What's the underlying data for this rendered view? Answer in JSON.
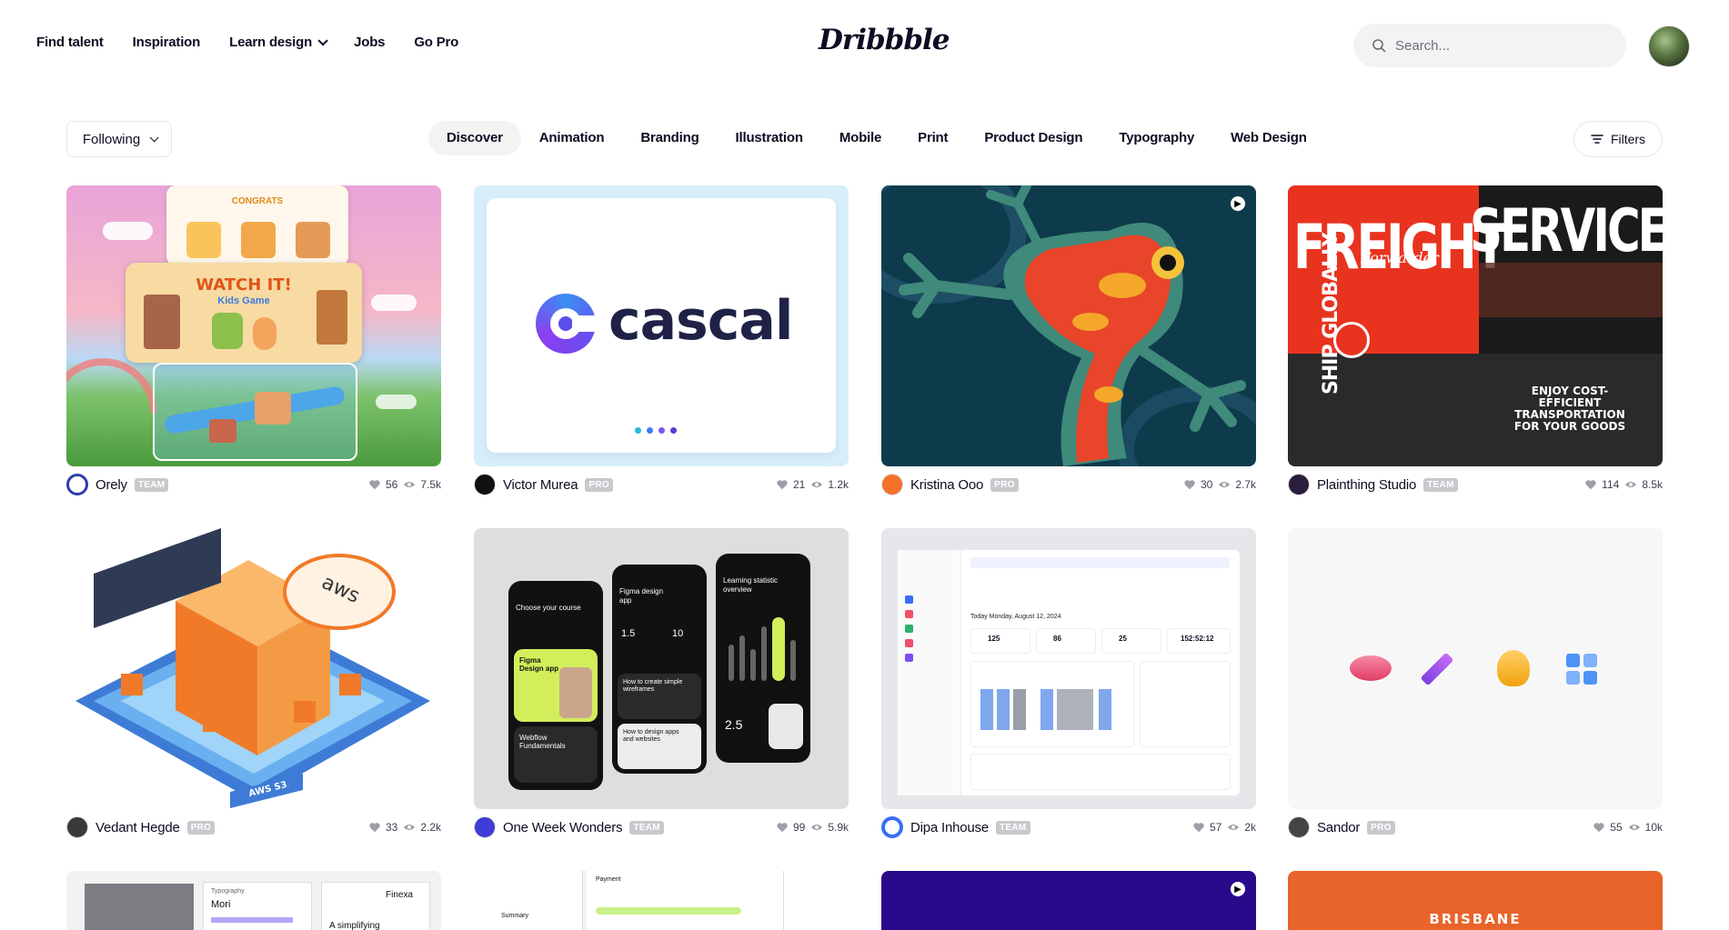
{
  "header": {
    "nav": [
      {
        "label": "Find talent"
      },
      {
        "label": "Inspiration"
      },
      {
        "label": "Learn design"
      },
      {
        "label": "Jobs"
      },
      {
        "label": "Go Pro"
      }
    ],
    "logo": "Dribbble",
    "search_placeholder": "Search..."
  },
  "filters_row": {
    "following": "Following",
    "categories": [
      "Discover",
      "Animation",
      "Branding",
      "Illustration",
      "Mobile",
      "Print",
      "Product Design",
      "Typography",
      "Web Design"
    ],
    "active_category": "Discover",
    "filters_label": "Filters"
  },
  "shots": [
    {
      "author": "Orely",
      "badge": "TEAM",
      "likes": "56",
      "views": "7.5k",
      "thumb_text_1": "WATCH IT!",
      "thumb_text_2": "Kids Game",
      "thumb_text_3": "CONGRATS"
    },
    {
      "author": "Victor Murea",
      "badge": "PRO",
      "likes": "21",
      "views": "1.2k",
      "thumb_text_1": "cascal"
    },
    {
      "author": "Kristina Ooo",
      "badge": "PRO",
      "likes": "30",
      "views": "2.7k"
    },
    {
      "author": "Plainthing Studio",
      "badge": "TEAM",
      "likes": "114",
      "views": "8.5k",
      "thumb_text_1": "FREIGHT",
      "thumb_text_2": "SERVICES",
      "thumb_text_3": "ENJOY COST-EFFICIENT TRANSPORTATION FOR YOUR GOODS",
      "thumb_text_4": "SHIP GLOBALLY",
      "thumb_text_5": "Forwarder"
    },
    {
      "author": "Vedant Hegde",
      "badge": "PRO",
      "likes": "33",
      "views": "2.2k",
      "thumb_text_1": "aws",
      "thumb_text_2": "AWS S3"
    },
    {
      "author": "One Week Wonders",
      "badge": "TEAM",
      "likes": "99",
      "views": "5.9k",
      "thumb_text_1": "Choose your course",
      "thumb_text_2": "Figma Design app",
      "thumb_text_3": "Figma design app",
      "thumb_text_4": "Learning statistic overview",
      "thumb_text_5": "Webflow Fundamentals",
      "thumb_text_6": "How to create simple wireframes",
      "thumb_text_7": "How to design apps and websites",
      "thumb_text_8": "1.5",
      "thumb_text_9": "10",
      "thumb_text_10": "2.5"
    },
    {
      "author": "Dipa Inhouse",
      "badge": "TEAM",
      "likes": "57",
      "views": "2k",
      "thumb_text_1": "Today Monday, August 12, 2024",
      "thumb_text_2": "125",
      "thumb_text_3": "86",
      "thumb_text_4": "25",
      "thumb_text_5": "152:52:12"
    },
    {
      "author": "Sandor",
      "badge": "PRO",
      "likes": "55",
      "views": "10k"
    }
  ],
  "row3": {
    "text_1": "Typography",
    "text_2": "Mori",
    "text_3": "Finexa",
    "text_4": "A simplifying",
    "text_5": "Payment",
    "text_6": "Summary",
    "text_7": "BRISBANE"
  }
}
